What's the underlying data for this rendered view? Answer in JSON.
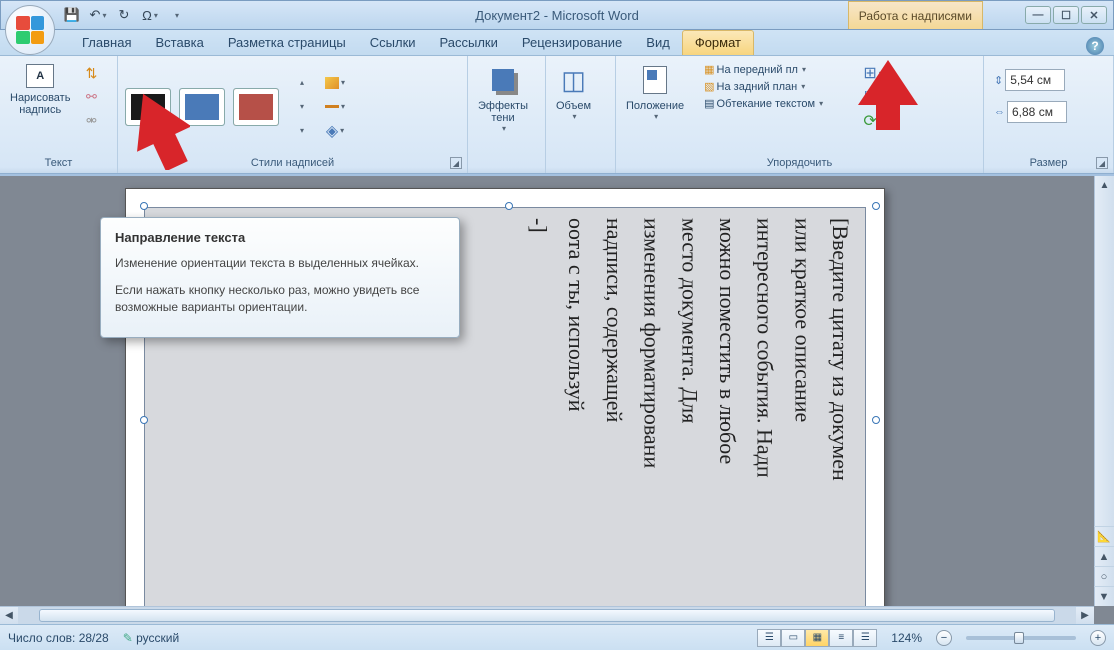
{
  "window": {
    "title": "Документ2 - Microsoft Word",
    "context_tab_title": "Работа с надписями"
  },
  "qat": {
    "save": "💾",
    "undo": "↶",
    "redo": "↻",
    "omega": "Ω"
  },
  "tabs": {
    "home": "Главная",
    "insert": "Вставка",
    "page_layout": "Разметка страницы",
    "references": "Ссылки",
    "mailings": "Рассылки",
    "review": "Рецензирование",
    "view": "Вид",
    "format": "Формат"
  },
  "ribbon": {
    "text_group": {
      "draw_textbox": "Нарисовать\nнадпись",
      "label": "Текст"
    },
    "styles_group": {
      "label": "Стили надписей"
    },
    "shadow_group": {
      "label": "Эффекты\nтени"
    },
    "volume_group": {
      "label": "Объем"
    },
    "position_group": {
      "label": "Положение"
    },
    "arrange_group": {
      "bring_front": "На передний пл",
      "send_back": "На задний план",
      "text_wrap": "Обтекание текстом",
      "label": "Упорядочить"
    },
    "size_group": {
      "height": "5,54 см",
      "width": "6,88 см",
      "label": "Размер"
    }
  },
  "tooltip": {
    "title": "Направление текста",
    "para1": "Изменение ориентации текста в выделенных ячейках.",
    "para2": "Если нажать кнопку несколько раз, можно увидеть все возможные варианты ориентации."
  },
  "document": {
    "lines": [
      "[Введите цитату из докумен",
      "или краткое описание",
      "интересного события. Надп",
      "можно поместить в любое",
      "место документа. Для",
      "изменения форматировани",
      "надписи, содержащей",
      "оота с    ты, используй",
      "-]"
    ]
  },
  "statusbar": {
    "word_count": "Число слов: 28/28",
    "language": "русский",
    "zoom": "124%"
  }
}
